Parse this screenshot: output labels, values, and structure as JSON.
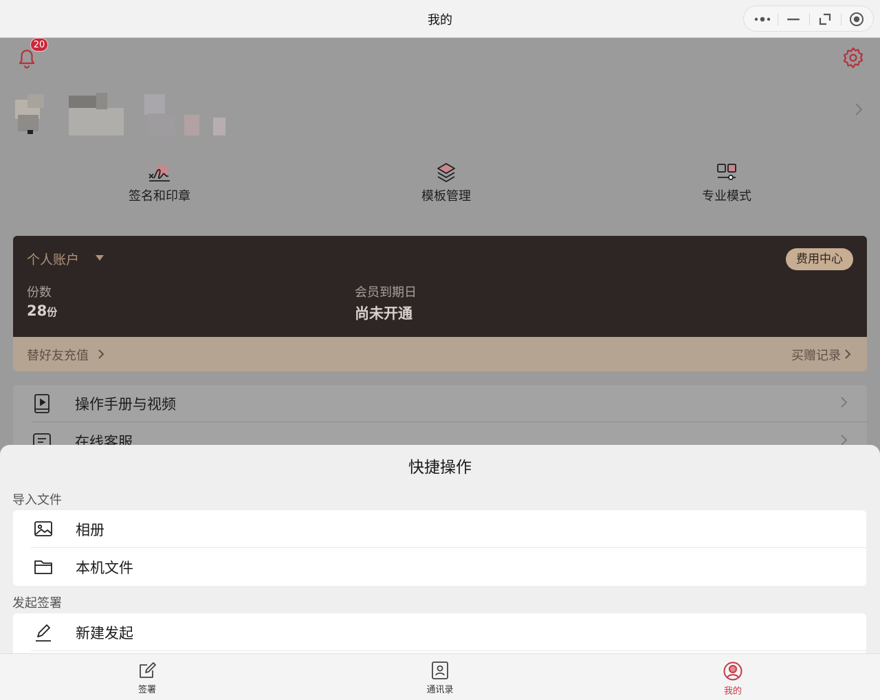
{
  "window": {
    "title": "我的"
  },
  "header": {
    "notification_count": "20"
  },
  "quick_entries": [
    {
      "label": "签名和印章",
      "icon": "signature-icon"
    },
    {
      "label": "模板管理",
      "icon": "layers-icon"
    },
    {
      "label": "专业模式",
      "icon": "pro-mode-icon"
    }
  ],
  "account": {
    "name": "个人账户",
    "fee_button": "费用中心",
    "copies_label": "份数",
    "copies_value": "28",
    "copies_unit": "份",
    "expiry_label": "会员到期日",
    "expiry_value": "尚未开通",
    "recharge_link": "替好友充值",
    "records_link": "买赠记录"
  },
  "menu": [
    {
      "label": "操作手册与视频",
      "icon": "manual-video-icon"
    },
    {
      "label": "在线客服",
      "icon": "chat-icon"
    }
  ],
  "sheet": {
    "title": "快捷操作",
    "import_section": "导入文件",
    "import_items": [
      {
        "label": "相册",
        "icon": "image-icon"
      },
      {
        "label": "本机文件",
        "icon": "folder-icon"
      }
    ],
    "sign_section": "发起签署",
    "sign_items": [
      {
        "label": "新建发起",
        "icon": "pen-icon"
      }
    ]
  },
  "tabbar": [
    {
      "label": "签署",
      "icon": "edit-icon",
      "active": false
    },
    {
      "label": "通讯录",
      "icon": "contacts-icon",
      "active": false
    },
    {
      "label": "我的",
      "icon": "user-icon",
      "active": true
    }
  ],
  "colors": {
    "accent": "#c43a45",
    "card_dark": "#2e2624",
    "gold": "#c7ad92"
  }
}
